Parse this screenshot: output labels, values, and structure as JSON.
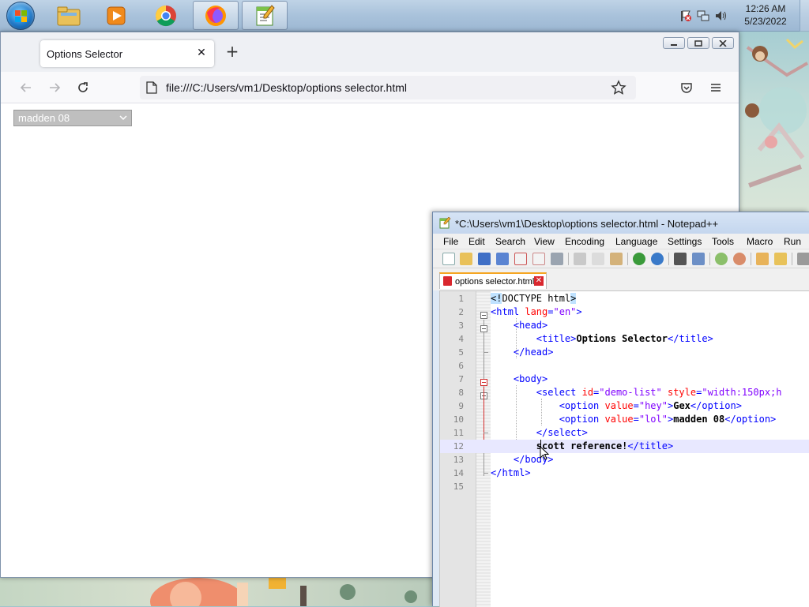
{
  "taskbar": {
    "clock_time": "12:26 AM",
    "clock_date": "5/23/2022",
    "apps": [
      {
        "name": "file-explorer"
      },
      {
        "name": "media-player"
      },
      {
        "name": "chrome"
      },
      {
        "name": "firefox"
      },
      {
        "name": "notepad-plus-plus"
      }
    ]
  },
  "firefox": {
    "tab_title": "Options Selector",
    "tab_close": "✕",
    "new_tab": "+",
    "url": "file:///C:/Users/vm1/Desktop/options selector.html",
    "select_value": "madden 08"
  },
  "notepad": {
    "title": "*C:\\Users\\vm1\\Desktop\\options selector.html - Notepad++",
    "menu": [
      "File",
      "Edit",
      "Search",
      "View",
      "Encoding",
      "Language",
      "Settings",
      "Tools",
      "Macro",
      "Run"
    ],
    "tab_label": "options selector.html",
    "tab_close": "✕",
    "lines": [
      {
        "n": "1",
        "parts": [
          {
            "t": "<!",
            "c": "doc"
          },
          {
            "t": "DOCTYPE html",
            "c": "txt-plain"
          },
          {
            "t": ">",
            "c": "doc"
          }
        ]
      },
      {
        "n": "2",
        "parts": [
          {
            "t": "<html ",
            "c": "tag"
          },
          {
            "t": "lang",
            "c": "attr"
          },
          {
            "t": "=",
            "c": "tag"
          },
          {
            "t": "\"en\"",
            "c": "val"
          },
          {
            "t": ">",
            "c": "tag"
          }
        ]
      },
      {
        "n": "3",
        "parts": [
          {
            "t": "    <head>",
            "c": "tag"
          }
        ]
      },
      {
        "n": "4",
        "parts": [
          {
            "t": "        <title>",
            "c": "tag"
          },
          {
            "t": "Options Selector",
            "c": "txt"
          },
          {
            "t": "</title>",
            "c": "tag"
          }
        ]
      },
      {
        "n": "5",
        "parts": [
          {
            "t": "    </head>",
            "c": "tag"
          }
        ]
      },
      {
        "n": "6",
        "parts": []
      },
      {
        "n": "7",
        "parts": [
          {
            "t": "    <body>",
            "c": "tag"
          }
        ]
      },
      {
        "n": "8",
        "parts": [
          {
            "t": "        <select ",
            "c": "tag"
          },
          {
            "t": "id",
            "c": "attr"
          },
          {
            "t": "=",
            "c": "tag"
          },
          {
            "t": "\"demo-list\" ",
            "c": "val"
          },
          {
            "t": "style",
            "c": "attr"
          },
          {
            "t": "=",
            "c": "tag"
          },
          {
            "t": "\"width:150px;h",
            "c": "val"
          }
        ]
      },
      {
        "n": "9",
        "parts": [
          {
            "t": "            <option ",
            "c": "tag"
          },
          {
            "t": "value",
            "c": "attr"
          },
          {
            "t": "=",
            "c": "tag"
          },
          {
            "t": "\"hey\"",
            "c": "val"
          },
          {
            "t": ">",
            "c": "tag"
          },
          {
            "t": "Gex",
            "c": "txt"
          },
          {
            "t": "</option>",
            "c": "tag"
          }
        ]
      },
      {
        "n": "10",
        "parts": [
          {
            "t": "            <option ",
            "c": "tag"
          },
          {
            "t": "value",
            "c": "attr"
          },
          {
            "t": "=",
            "c": "tag"
          },
          {
            "t": "\"lol\"",
            "c": "val"
          },
          {
            "t": ">",
            "c": "tag"
          },
          {
            "t": "madden 08",
            "c": "txt"
          },
          {
            "t": "</option>",
            "c": "tag"
          }
        ]
      },
      {
        "n": "11",
        "parts": [
          {
            "t": "        </select>",
            "c": "tag"
          }
        ]
      },
      {
        "n": "12",
        "parts": [
          {
            "t": "        scott reference!",
            "c": "txt"
          },
          {
            "t": "</title>",
            "c": "tag"
          }
        ],
        "current": true
      },
      {
        "n": "13",
        "parts": [
          {
            "t": "    </body>",
            "c": "tag"
          }
        ]
      },
      {
        "n": "14",
        "parts": [
          {
            "t": "</html>",
            "c": "tag"
          }
        ]
      },
      {
        "n": "15",
        "parts": []
      }
    ]
  },
  "colors": {
    "tag": "#0000ff",
    "attr": "#ff0000",
    "val": "#8000ff",
    "doctype_highlight": "#bfe2ff",
    "current_line": "#e8e8ff",
    "tab_accent": "#f5a623"
  }
}
